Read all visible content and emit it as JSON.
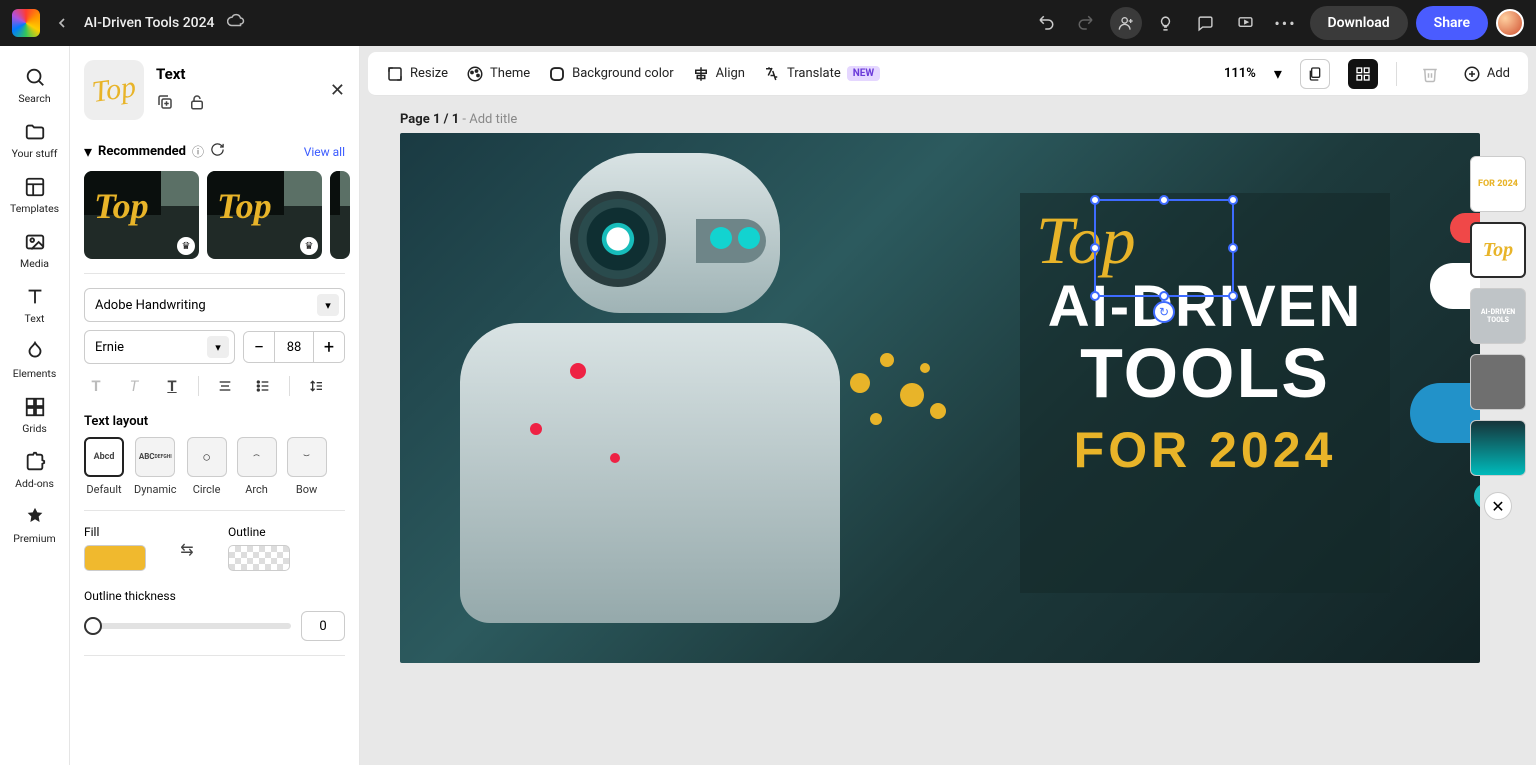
{
  "header": {
    "doc_title": "AI-Driven Tools 2024",
    "download": "Download",
    "share": "Share"
  },
  "rail": {
    "search": "Search",
    "your_stuff": "Your stuff",
    "templates": "Templates",
    "media": "Media",
    "text": "Text",
    "elements": "Elements",
    "grids": "Grids",
    "addons": "Add-ons",
    "premium": "Premium"
  },
  "panel": {
    "title": "Text",
    "thumb_text": "Top",
    "recommended_label": "Recommended",
    "view_all": "View all",
    "rec_card_text": "Top",
    "font_family": "Adobe Handwriting",
    "font_style": "Ernie",
    "font_size": "88",
    "text_layout_label": "Text layout",
    "layouts": {
      "default": "Default",
      "dynamic": "Dynamic",
      "circle": "Circle",
      "arch": "Arch",
      "bow": "Bow"
    },
    "fill_label": "Fill",
    "outline_label": "Outline",
    "fill_color": "#f0b92e",
    "outline_thickness_label": "Outline thickness",
    "outline_thickness": "0"
  },
  "toolbar": {
    "resize": "Resize",
    "theme": "Theme",
    "bg_color": "Background color",
    "align": "Align",
    "translate": "Translate",
    "translate_badge": "NEW",
    "zoom": "111%",
    "add": "Add"
  },
  "stage": {
    "page_num": "Page 1 / 1",
    "add_title": "Add title",
    "text_top": "Top",
    "line1": "AI-DRIVEN",
    "line2": "TOOLS",
    "for_line": "FOR 2024"
  },
  "thumbs": {
    "t1": "FOR 2024",
    "t3": "AI-DRIVEN\nTOOLS"
  }
}
